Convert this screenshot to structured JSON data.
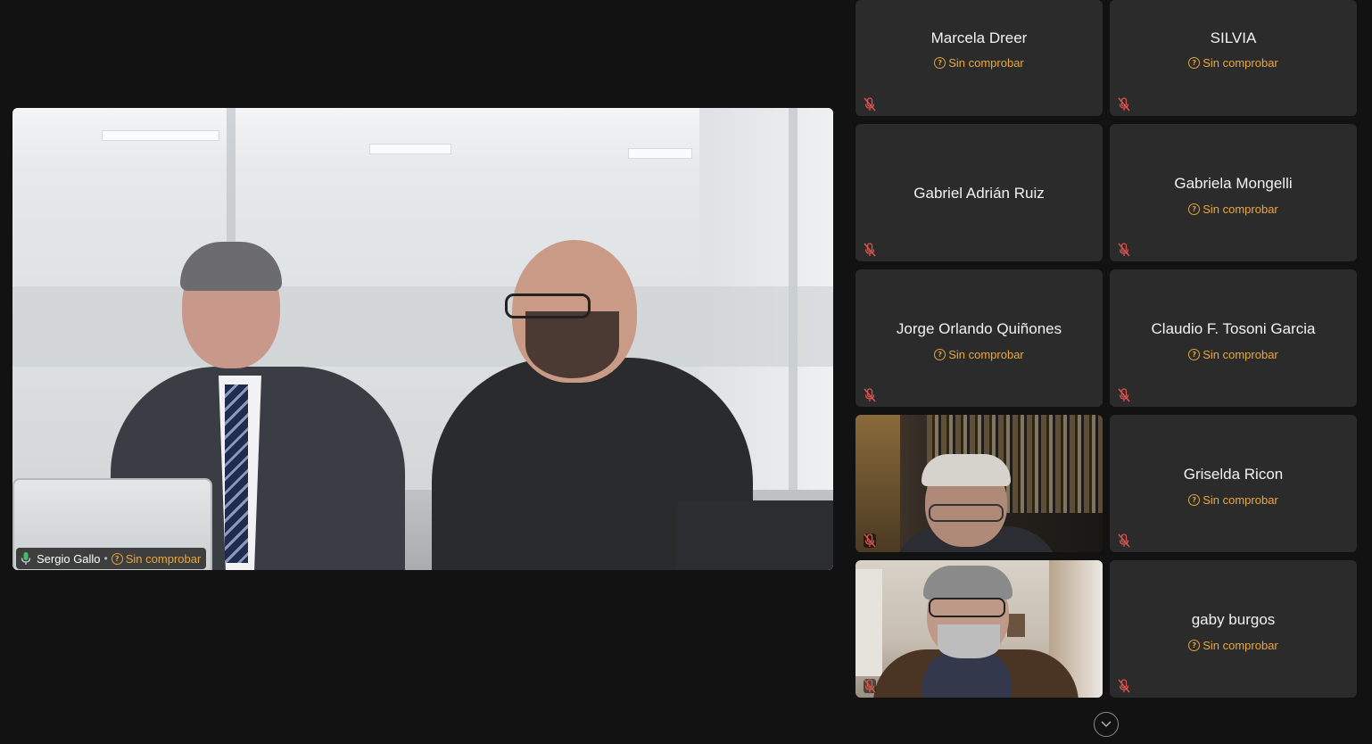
{
  "main_video": {
    "participant_name": "Sergio Gallo",
    "separator": "•",
    "status": "Sin comprobar",
    "mic_state": "on"
  },
  "tiles": [
    {
      "name": "Marcela Dreer",
      "status": "Sin comprobar",
      "muted": true
    },
    {
      "name": "SILVIA",
      "status": "Sin comprobar",
      "muted": true
    },
    {
      "name": "Gabriel Adrián Ruiz",
      "status": "",
      "muted": true
    },
    {
      "name": "Gabriela Mongelli",
      "status": "Sin comprobar",
      "muted": true
    },
    {
      "name": "Jorge Orlando Quiñones",
      "status": "Sin comprobar",
      "muted": true
    },
    {
      "name": "Claudio F. Tosoni Garcia",
      "status": "Sin comprobar",
      "muted": true
    },
    {
      "name": "",
      "status": "",
      "muted": true,
      "video": true
    },
    {
      "name": "Griselda Ricon",
      "status": "Sin comprobar",
      "muted": true
    },
    {
      "name": "",
      "status": "",
      "muted": true,
      "video": true
    },
    {
      "name": "gaby burgos",
      "status": "Sin comprobar",
      "muted": true
    }
  ],
  "colors": {
    "background": "#121212",
    "tile": "#2b2b2b",
    "status_warning": "#e8a83c",
    "muted_icon": "#d9534f"
  },
  "icons": {
    "status": "question-circle-icon",
    "muted": "mic-off-icon",
    "mic": "mic-on-icon",
    "scroll": "chevron-down-icon"
  }
}
